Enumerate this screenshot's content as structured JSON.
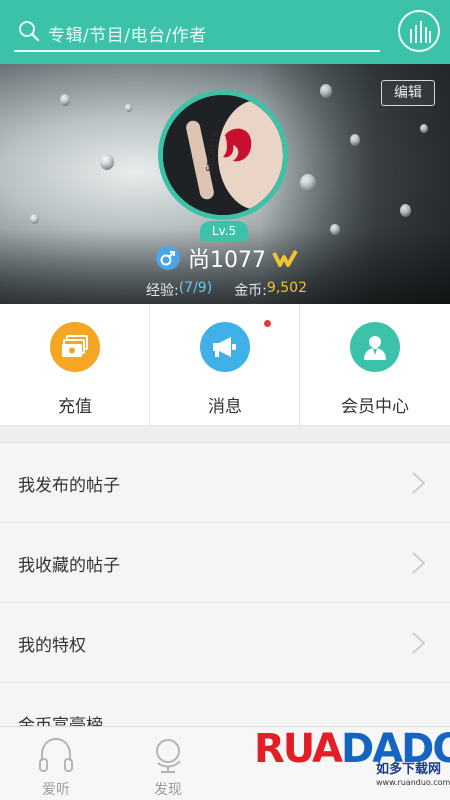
{
  "search": {
    "placeholder": "专辑/节目/电台/作者"
  },
  "profile": {
    "edit_label": "编辑",
    "level": "Lv.5",
    "username": "尚1077",
    "exp_label": "经验:",
    "exp_value": "(7/9)",
    "coin_label": "金币:",
    "coin_value": "9,502"
  },
  "actions": [
    {
      "label": "充值",
      "icon": "wallet-icon",
      "color": "#f5a623"
    },
    {
      "label": "消息",
      "icon": "megaphone-icon",
      "color": "#3fb0e8",
      "has_dot": true
    },
    {
      "label": "会员中心",
      "icon": "member-icon",
      "color": "#3cc2a8"
    }
  ],
  "list": [
    {
      "label": "我发布的帖子"
    },
    {
      "label": "我收藏的帖子"
    },
    {
      "label": "我的特权"
    },
    {
      "label": "金币富豪榜"
    }
  ],
  "bottom_nav": [
    {
      "label": "爱听",
      "icon": "headphones-icon"
    },
    {
      "label": "发现",
      "icon": "globe-icon"
    }
  ],
  "watermark": {
    "brand": "RUANDADO",
    "cn": "如多下载网",
    "url": "www.ruanduo.com"
  },
  "colors": {
    "accent": "#3cc2a8",
    "orange": "#f5a623",
    "blue": "#3fb0e8",
    "gold": "#f1c232"
  }
}
